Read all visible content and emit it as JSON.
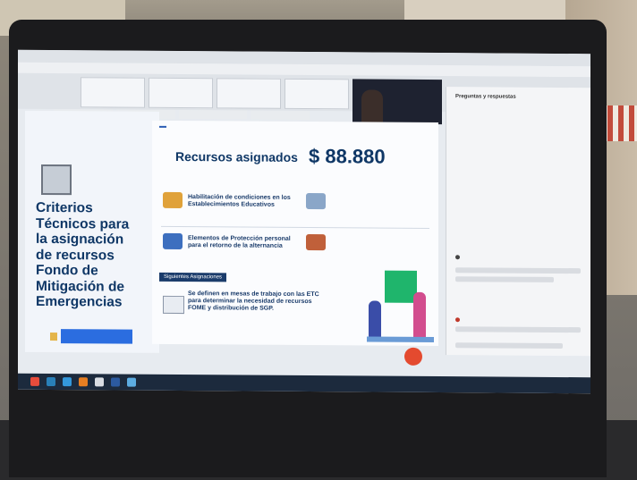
{
  "slide_left": {
    "criteria_lines": [
      "Criterios",
      "Técnicos para",
      "la asignación",
      "de recursos",
      "Fondo de",
      "Mitigación de",
      "Emergencias"
    ]
  },
  "slide_main": {
    "tag": "",
    "subtitle": "",
    "title": "Recursos asignados",
    "amount": "$ 88.880",
    "amount_caption": "",
    "items": [
      {
        "label": "",
        "text": "Habilitación de condiciones en los Establecimientos Educativos",
        "right": ""
      },
      {
        "label": "",
        "text": "Elementos de Protección personal para el retorno de la alternancia",
        "right": ""
      }
    ],
    "next_tag": "Siguientes Asignaciones",
    "bottom_label": "",
    "bottom_text": "Se definen en mesas de trabajo con las ETC para determinar la necesidad de recursos FOME y distribución de SGP.",
    "bottom_note": ""
  },
  "chat": {
    "title": "Preguntas y respuestas",
    "sub": ""
  },
  "colors": {
    "accent": "#0f3766",
    "record": "#e44a2f",
    "taskbar": "#1c2a3d"
  }
}
